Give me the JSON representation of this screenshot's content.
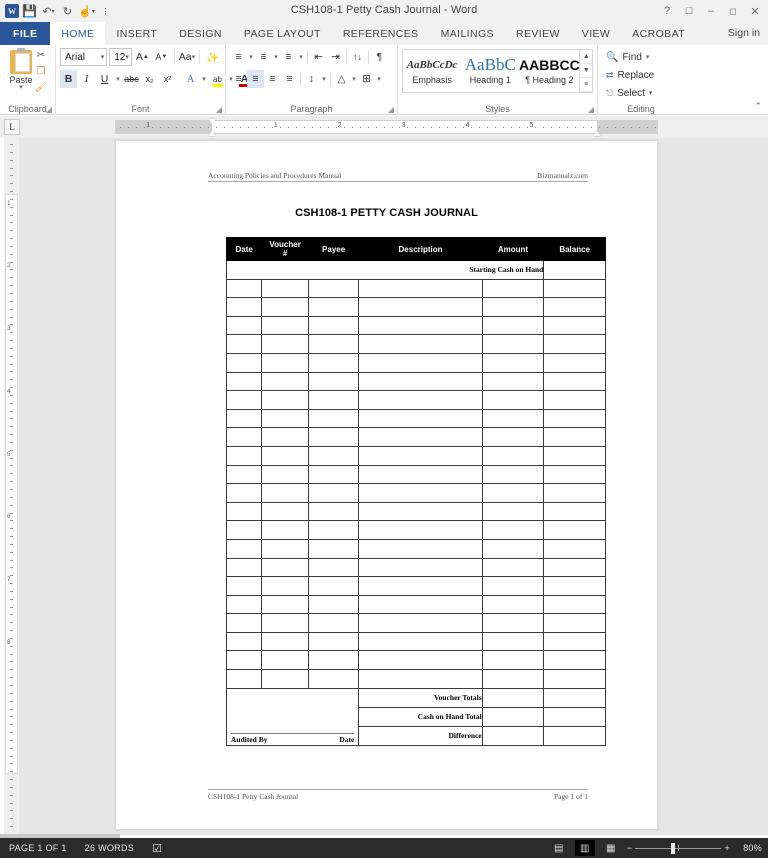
{
  "window": {
    "title": "CSH108-1 Petty Cash Journal - Word",
    "app_logo": "word-logo",
    "quick_access": [
      {
        "name": "save-icon",
        "glyph": "ὋE"
      },
      {
        "name": "undo-icon",
        "glyph": "↶"
      },
      {
        "name": "redo-icon",
        "glyph": "↻"
      },
      {
        "name": "touch-mode-icon",
        "glyph": "☝"
      },
      {
        "name": "customize-qat-icon",
        "glyph": "≡"
      }
    ],
    "controls": [
      {
        "name": "help-button",
        "glyph": "?"
      },
      {
        "name": "ribbon-display-options-button",
        "glyph": "⬜"
      },
      {
        "name": "minimize-button",
        "glyph": "–"
      },
      {
        "name": "restore-button",
        "glyph": "❐"
      },
      {
        "name": "close-button",
        "glyph": "✕"
      }
    ]
  },
  "ribbon": {
    "file_tab": "FILE",
    "tabs": [
      "HOME",
      "INSERT",
      "DESIGN",
      "PAGE LAYOUT",
      "REFERENCES",
      "MAILINGS",
      "REVIEW",
      "VIEW",
      "ACROBAT"
    ],
    "active_tab": "HOME",
    "sign_in": "Sign in",
    "groups": {
      "clipboard": {
        "label": "Clipboard",
        "paste_label": "Paste",
        "cut_label": "Cut",
        "copy_label": "Copy",
        "format_painter_label": "Format Painter"
      },
      "font": {
        "label": "Font",
        "font_family": "Arial",
        "font_size": "12",
        "grow_font": "A",
        "shrink_font": "A",
        "change_case": "Aa",
        "clear_formatting": "A",
        "bold": "B",
        "italic": "I",
        "underline": "U",
        "strikethrough": "abc",
        "subscript": "x₂",
        "superscript": "x²",
        "text_effects": "A",
        "highlight": "ab",
        "font_color": "A"
      },
      "paragraph": {
        "label": "Paragraph",
        "bullets": "≡",
        "numbering": "≡",
        "multilevel": "≡",
        "decrease_indent": "⇤",
        "increase_indent": "⇥",
        "sort": "↑↓",
        "show_marks": "¶",
        "align_left": "≡",
        "align_center": "≡",
        "align_right": "≡",
        "justify": "≡",
        "line_spacing": "↕",
        "shading": "△",
        "borders": "⊞"
      },
      "styles": {
        "label": "Styles",
        "items": [
          {
            "preview": "AaBbCcDc",
            "name": "Emphasis"
          },
          {
            "preview": "AaBbC",
            "name": "Heading 1"
          },
          {
            "preview": "AABBCC",
            "name": "¶ Heading 2"
          }
        ],
        "scroll_up": "▲",
        "scroll_down": "▼",
        "more": "≡"
      },
      "editing": {
        "label": "Editing",
        "find": "Find",
        "replace": "Replace",
        "select": "Select"
      }
    },
    "collapse_icon": "⌃"
  },
  "ruler": {
    "tab_selector": "L",
    "horizontal_numbers": [
      "1",
      "1",
      "2",
      "3",
      "4",
      "5"
    ],
    "vertical_numbers": [
      "1",
      "2",
      "3",
      "4",
      "5",
      "6",
      "7",
      "8"
    ]
  },
  "document": {
    "header": {
      "left": "Accounting Policies and Procedures Manual",
      "right": "Bizmanualz.com"
    },
    "title": "CSH108-1 PETTY CASH JOURNAL",
    "footer": {
      "left": "CSH108-1 Petty Cash Journal",
      "right": "Page 1 of 1"
    },
    "table": {
      "columns": [
        "Date",
        "Voucher\n#",
        "Payee",
        "Description",
        "Amount",
        "Balance"
      ],
      "columns_flat": [
        "Date",
        "Voucher #",
        "Payee",
        "Description",
        "Amount",
        "Balance"
      ],
      "starting_row_label": "Starting Cash on Hand",
      "blank_row_count": 22,
      "totals": [
        "Voucher Totals",
        "Cash on Hand Total",
        "Difference"
      ],
      "audit": {
        "signature_label": "Audited By",
        "date_label": "Date"
      }
    }
  },
  "status_bar": {
    "page_indicator": "PAGE 1 OF 1",
    "word_count": "26 WORDS",
    "proofing_icon": "proofing-errors-icon",
    "views": [
      {
        "name": "read-mode-button",
        "glyph": "▤",
        "selected": false
      },
      {
        "name": "print-layout-button",
        "glyph": "▥",
        "selected": true
      },
      {
        "name": "web-layout-button",
        "glyph": "▦",
        "selected": false
      }
    ],
    "zoom_out": "−",
    "zoom_in": "+",
    "zoom_level": "80%"
  }
}
